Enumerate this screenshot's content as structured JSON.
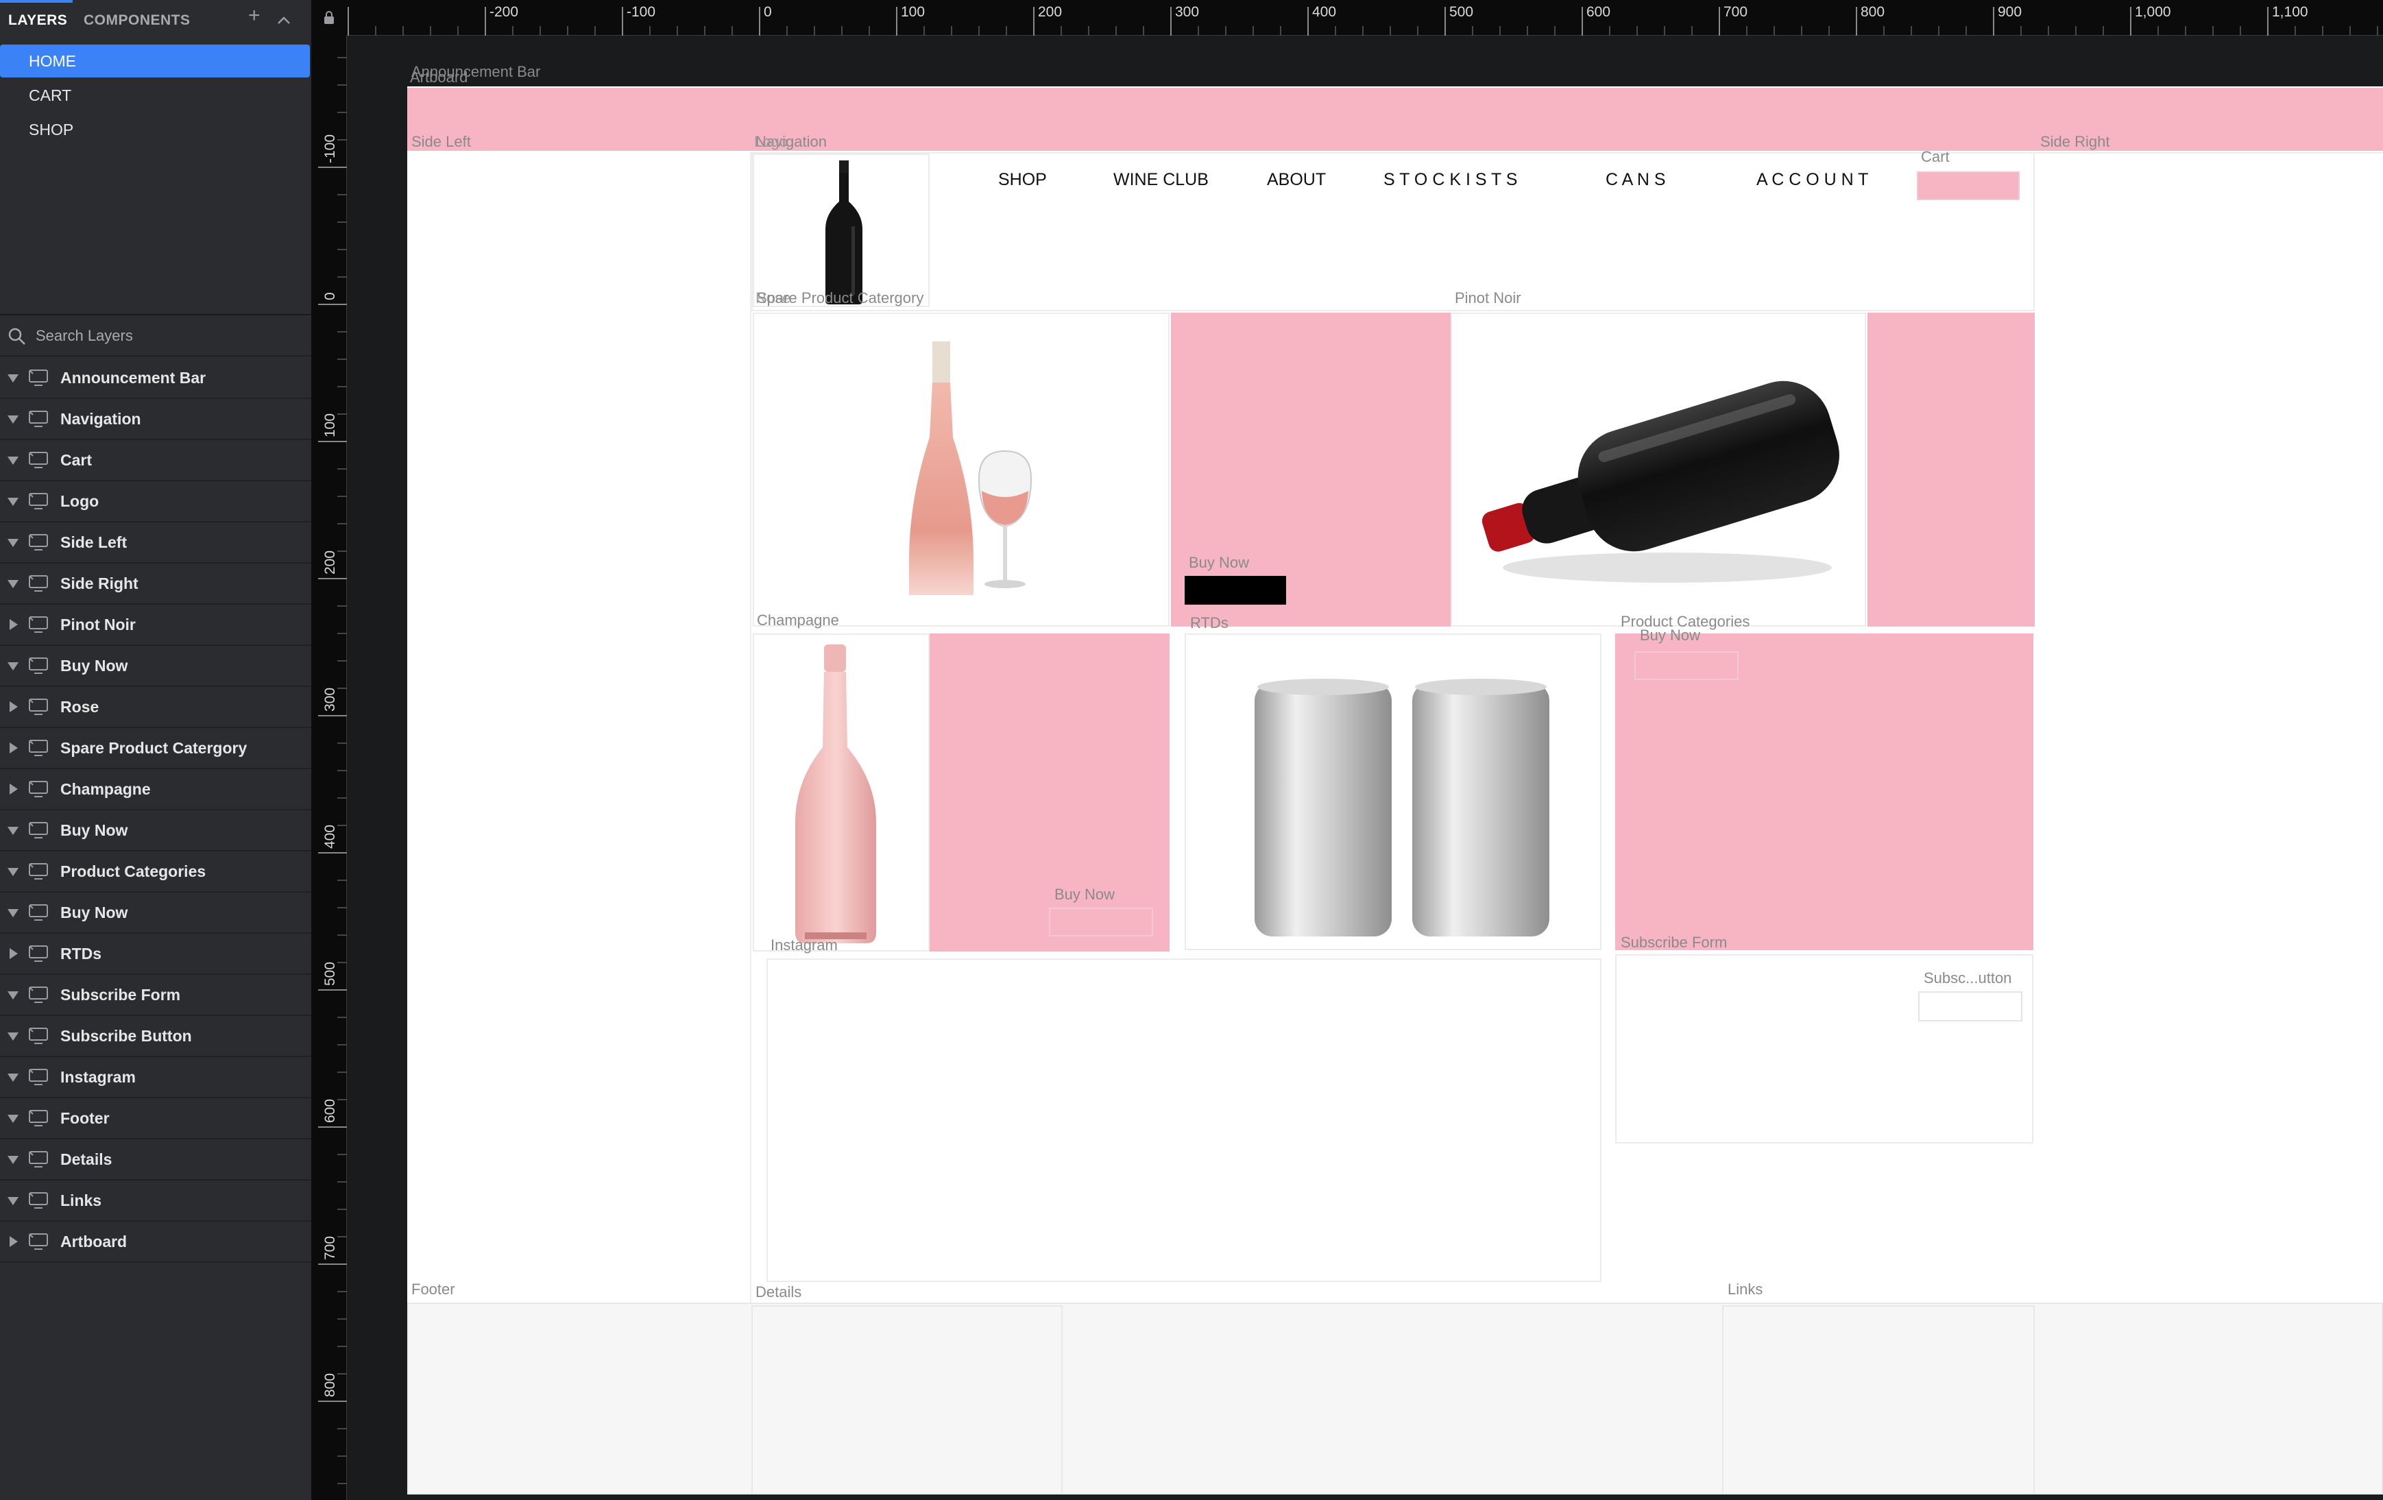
{
  "panel": {
    "tabs": [
      {
        "label": "LAYERS"
      },
      {
        "label": "COMPONENTS"
      }
    ],
    "pages": [
      {
        "label": "HOME"
      },
      {
        "label": "CART"
      },
      {
        "label": "SHOP"
      }
    ],
    "search": {
      "placeholder": "Search Layers"
    },
    "layers": [
      {
        "label": "Announcement Bar",
        "expanded": true
      },
      {
        "label": "Navigation",
        "expanded": true
      },
      {
        "label": "Cart",
        "expanded": true
      },
      {
        "label": "Logo",
        "expanded": true
      },
      {
        "label": "Side Left",
        "expanded": true
      },
      {
        "label": "Side Right",
        "expanded": true
      },
      {
        "label": "Pinot Noir",
        "expanded": false
      },
      {
        "label": "Buy Now",
        "expanded": true
      },
      {
        "label": "Rose",
        "expanded": false
      },
      {
        "label": "Spare Product Catergory",
        "expanded": false
      },
      {
        "label": "Champagne",
        "expanded": false
      },
      {
        "label": "Buy Now",
        "expanded": true
      },
      {
        "label": "Product Categories",
        "expanded": true
      },
      {
        "label": "Buy Now",
        "expanded": true
      },
      {
        "label": "RTDs",
        "expanded": false
      },
      {
        "label": "Subscribe Form",
        "expanded": true
      },
      {
        "label": "Subscribe Button",
        "expanded": true
      },
      {
        "label": "Instagram",
        "expanded": true
      },
      {
        "label": "Footer",
        "expanded": true
      },
      {
        "label": "Details",
        "expanded": true
      },
      {
        "label": "Links",
        "expanded": true
      },
      {
        "label": "Artboard",
        "expanded": false
      }
    ]
  },
  "ruler": {
    "top": [
      "-200",
      "-100",
      "0",
      "100",
      "200",
      "300",
      "400",
      "500",
      "600",
      "700",
      "800",
      "900",
      "1,000",
      "1,100"
    ],
    "left": [
      "-100",
      "0",
      "100",
      "200",
      "300",
      "400",
      "500",
      "600",
      "700",
      "800"
    ]
  },
  "canvas": {
    "labels": {
      "artboard": "Artboard",
      "announcement_bar": "Announcement Bar",
      "side_left": "Side Left",
      "logo": "Logo",
      "navigation": "Navigation",
      "cart": "Cart",
      "side_right": "Side Right",
      "rose": "Rose",
      "spare": "Spare Product Catergory",
      "pinot": "Pinot Noir",
      "buy_now_1": "Buy Now",
      "champagne": "Champagne",
      "rtds": "RTDs",
      "product_categories": "Product Categories",
      "buy_now_2": "Buy Now",
      "buy_now_3": "Buy Now",
      "instagram": "Instagram",
      "subscribe_form": "Subscribe Form",
      "subscribe_button": "Subsc...utton",
      "footer": "Footer",
      "details": "Details",
      "links": "Links"
    },
    "nav": [
      "SHOP",
      "WINE CLUB",
      "ABOUT",
      "S T O C K I S T S",
      "C A N S",
      "A C C O U N T"
    ]
  },
  "colors": {
    "accent": "#3b82f6",
    "pink": "#f7b5c4",
    "canvas_bg": "#1a1b1d",
    "panel_bg": "#2b2c2f"
  }
}
